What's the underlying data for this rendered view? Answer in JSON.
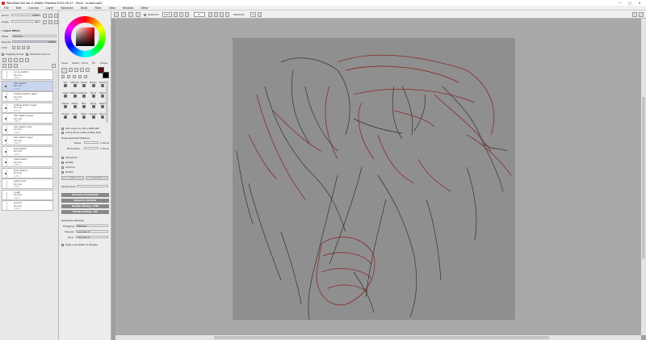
{
  "window": {
    "title": "PaintTool SAI Ver.2 (64bit) Preview.2022.05.27 - Paris - lineart.sai2",
    "controls": [
      "—",
      "□",
      "×"
    ]
  },
  "menu": [
    "File",
    "Edit",
    "Canvas",
    "Layer",
    "Selection",
    "Build",
    "Filter",
    "View",
    "Window",
    "Other"
  ],
  "nav_panel": {
    "zoom_label": "Zoom",
    "zoom_value": "100%",
    "angle_label": "Angle",
    "angle_value": "0°"
  },
  "layer_effect": {
    "heading": "Layer Effect",
    "mode_label": "Mode",
    "mode_value": "Normal",
    "opacity_label": "Opacity",
    "opacity_value": "100%",
    "lock_label": "Lock",
    "clipping_label": "Clipping Group",
    "selection_source_label": "Selection Source"
  },
  "layers": [
    {
      "name": "curve sketch",
      "mode": "Normal",
      "opacity": "100%",
      "visible": false,
      "selected": false
    },
    {
      "name": "hair sketch",
      "mode": "Normal",
      "opacity": "100%",
      "visible": true,
      "selected": true
    },
    {
      "name": "clothes sketch upper",
      "mode": "Normal",
      "opacity": "100%",
      "visible": true,
      "selected": false
    },
    {
      "name": "clothes sketch lower",
      "mode": "Normal",
      "opacity": "100%",
      "visible": true,
      "selected": false
    },
    {
      "name": "hair sketch upper",
      "mode": "Normal",
      "opacity": "100%",
      "visible": true,
      "selected": false
    },
    {
      "name": "hair sketch misc",
      "mode": "Normal",
      "opacity": "100%",
      "visible": true,
      "selected": false
    },
    {
      "name": "hair sketch lower",
      "mode": "Normal",
      "opacity": "100%",
      "visible": true,
      "selected": false
    },
    {
      "name": "face sketch",
      "mode": "Normal",
      "opacity": "100%",
      "visible": true,
      "selected": false
    },
    {
      "name": "head sketch",
      "mode": "Normal",
      "opacity": "100%",
      "visible": true,
      "selected": false
    },
    {
      "name": "body sketch",
      "mode": "Normal",
      "opacity": "100%",
      "visible": true,
      "selected": false
    },
    {
      "name": "guide lines",
      "mode": "Normal",
      "opacity": "100%",
      "visible": false,
      "selected": false
    },
    {
      "name": "rough",
      "mode": "Normal",
      "opacity": "100%",
      "visible": false,
      "selected": false
    },
    {
      "name": "ground",
      "mode": "Normal",
      "opacity": "100%",
      "visible": false,
      "selected": false
    }
  ],
  "tool_panel": {
    "tabs": [
      "Layer",
      "Select",
      "Move",
      "Fill",
      "Shape"
    ],
    "brushes": [
      "Pen",
      "AirBrush",
      "Brush",
      "Marker",
      "Eraser",
      "Crown",
      "Watercolor",
      "Mixed",
      "Pencil",
      "Pastel",
      "Marker",
      "Stamp",
      "Blur",
      "Spray",
      "Sketch",
      "Contour",
      "Draw",
      "Water",
      "Sharpen",
      "Blend"
    ],
    "options": {
      "pick_layer": "Pick Layer by Ctrl+LMOUSE",
      "cut_move": "Cut & Move without Max Size",
      "drag_selected_distance": "Drag Selected Distance",
      "move_label": "Move",
      "move_value": "1.00 px",
      "fill_move_label": "Fill & Move",
      "fill_move_value": "1.00 px",
      "transform_options": [
        "Transform",
        "Rotate",
        "Uniform",
        "Pinfolk"
      ],
      "ok": "OK",
      "cancel": "Cancel",
      "perspective_label": "Perspective",
      "buttons": [
        "Reverse Horizontal",
        "Reverse Vertical",
        "Rotate 90deg. CCW",
        "Rotate 90deg. CW"
      ],
      "resample_heading": "Resample Settings",
      "dragging_label": "Dragging",
      "dragging_value": "Bilinear",
      "preview_label": "Preview",
      "preview_value": "Lanczos 3",
      "final_label": "Final",
      "final_value": "Lanczos 3",
      "keep_line_width": "Keep Line Width of Shapes"
    }
  },
  "toolbar": {
    "selection_label": "Selection",
    "zoom_value": "100%",
    "angle_value": "0°",
    "stabilizer_label": "Stabilizer",
    "stabilizer_value": "15"
  },
  "colors": {
    "foreground": "#5a1010",
    "background": "#000000",
    "sketch_red": "#8a2a2a",
    "sketch_dark": "#3a3a3a",
    "paper": "#8f8f8f"
  }
}
